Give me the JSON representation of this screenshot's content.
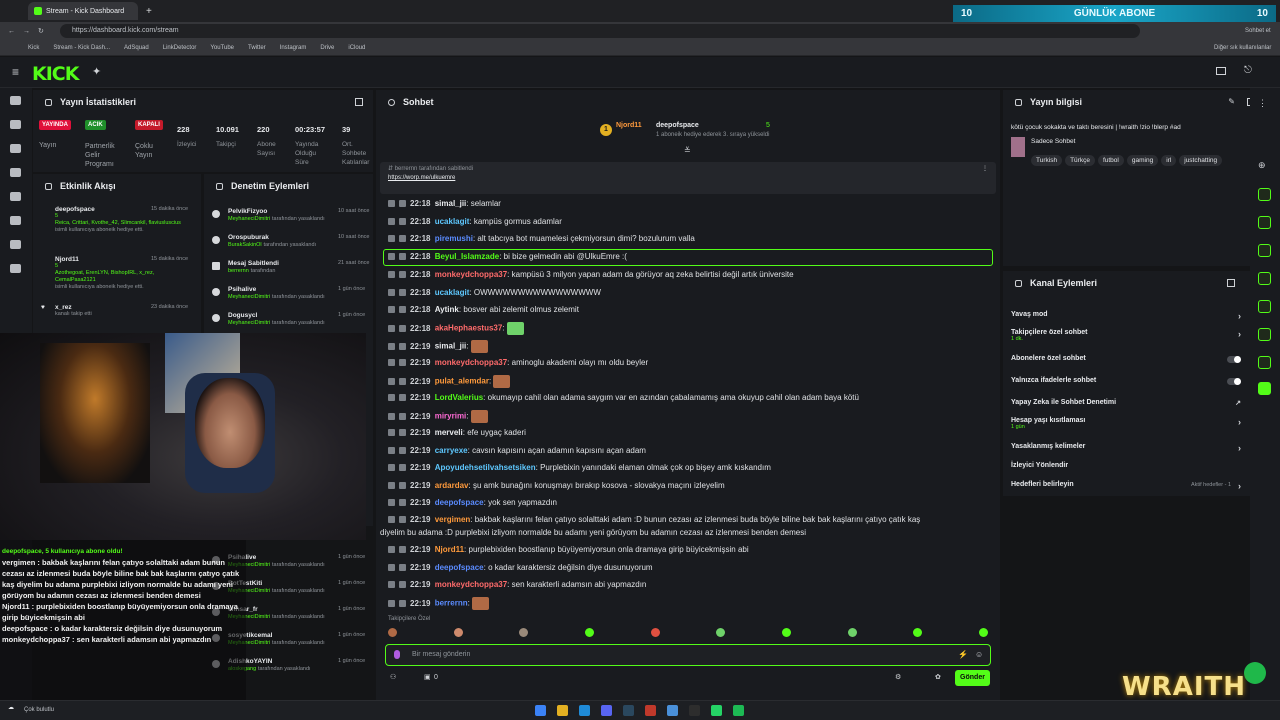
{
  "browser": {
    "tab_title": "Stream - Kick Dashboard",
    "url": "https://dashboard.kick.com/stream",
    "bookmarks": [
      "Kick",
      "Stream - Kick Dash...",
      "AdSquad",
      "LinkDetector",
      "YouTube",
      "Twitter",
      "Instagram",
      "Drive",
      "iCloud"
    ],
    "other_bookmarks": "Diğer sık kullanılanlar",
    "profile_btn": "Sohbet et"
  },
  "overlay_banner": {
    "left": "10",
    "title": "GÜNLÜK ABONE",
    "right": "10"
  },
  "stats": {
    "title": "Yayın İstatistikleri",
    "cols": [
      {
        "badge": "YAYINDA",
        "label": "Yayın"
      },
      {
        "badge": "ACIK",
        "label": "Partnerlik Gelir Programı"
      },
      {
        "badge": "KAPALI",
        "label": "Çoklu Yayın"
      }
    ],
    "nums": [
      {
        "v": "228",
        "l": "İzleyici"
      },
      {
        "v": "10.091",
        "l": "Takipçi"
      },
      {
        "v": "220",
        "l": "Abone Sayısı"
      },
      {
        "v": "00:23:57",
        "l": "Yayında Olduğu Süre"
      },
      {
        "v": "39",
        "l": "Ort. Sohbete Katılanlar"
      }
    ]
  },
  "activity": {
    "title": "Etkinlik Akışı",
    "items": [
      {
        "name": "deepofspace",
        "time": "15 dakika önce",
        "sub": "5",
        "list": "Reica, Crittari, Kvothe_42, Slimcankil, flaviusluscius",
        "note": "isimli kullanıcıya aboneik hediye etti."
      },
      {
        "name": "Njord11",
        "time": "15 dakika önce",
        "sub": "5",
        "list": "Azothegoat, ErenLYN, BishopIRL, x_rez, CemalPasa2121",
        "note": "isimli kullanıcıya aboneik hediye etti."
      },
      {
        "name": "x_rez",
        "time": "23 dakika önce",
        "note": "kanalı takip etti"
      }
    ]
  },
  "audit": {
    "title": "Denetim Eylemleri",
    "items": [
      {
        "name": "PelvikFizyoo",
        "time": "10 saat önce",
        "by": "MeyhaneciDimitri",
        "act": "tarafından yasaklandı"
      },
      {
        "name": "Orospuburak",
        "time": "10 saat önce",
        "by": "BurakSakinOl",
        "act": "tarafından yasaklandı"
      },
      {
        "name": "Mesaj Sabitlendi",
        "time": "21 saat önce",
        "by": "berrernn",
        "act": "tarafından"
      },
      {
        "name": "Psihalive",
        "time": "1 gün önce",
        "by": "MeyhaneciDimitri",
        "act": "tarafından yasaklandı"
      },
      {
        "name": "Dogusycl",
        "time": "1 gün önce",
        "by": "MeyhaneciDimitri",
        "act": "tarafından yasaklandı"
      }
    ],
    "items2": [
      {
        "name": "Psihalive",
        "time": "1 gün önce",
        "by": "MeyhaneciDimitri",
        "act": "tarafından yasaklandı"
      },
      {
        "name": "BotTestKiti",
        "time": "1 gün önce",
        "by": "MeyhaneciDimitri",
        "act": "tarafından yasaklandı"
      },
      {
        "name": "ennsar_fr",
        "time": "1 gün önce",
        "by": "MeyhaneciDimitri",
        "act": "tarafından yasaklandı"
      },
      {
        "name": "sosyetikcemal",
        "time": "1 gün önce",
        "by": "MeyhaneciDimitri",
        "act": "tarafından yasaklandı"
      },
      {
        "name": "AdishkoYAYIN",
        "time": "1 gün önce",
        "by": "aloskegang",
        "act": "tarafından yasaklandı"
      }
    ]
  },
  "overlay_chat": [
    "deepofspace, 5 kullanıcıya abone oldu!",
    "vergimen : bakbak kaşlarını felan çatıyo solalttaki adam bunun cezası az izlenmesi buda böyle biline bak bak kaşlarını çatıyo çatık kaş diyelim bu adama purplebixi izliyom normalde bu adamı yeni görüyom bu adamın cezası az izlenmesi benden demesi",
    "Njord11 : purplebixiden boostlanıp büyüyemiyorsun onla dramaya girip büyicekmişsin abi",
    "deepofspace : o kadar karaktersiz değilsin diye dusunuyorum",
    "monkeydchoppa37 : sen karakterli adamsın abi yapmazdın"
  ],
  "chat": {
    "title": "Sohbet",
    "top_user": "Njord11",
    "top_user2": "deepofspace",
    "top_count": "5",
    "top_note": "1 aboneik hediye ederek 3. sıraya yükseldi",
    "top_rank": "1",
    "pinned_by": "berrernn",
    "pinned_by_suffix": "tarafından sabitlendi",
    "pinned_link": "https://worp.me/ulkuemre",
    "messages": [
      {
        "t": "22:18",
        "u": "simal_jii",
        "c": "#e9ebee",
        "m": "selamlar"
      },
      {
        "t": "22:18",
        "u": "ucaklagit",
        "c": "#5ec8ff",
        "m": "kampüs gormus adamlar"
      },
      {
        "t": "22:18",
        "u": "piremushi",
        "c": "#5b8cff",
        "m": "alt tabcıya bot muamelesi çekmiyorsun dimi? bozulurum valla"
      },
      {
        "t": "22:18",
        "u": "Beyul_Islamzade",
        "c": "#53fc18",
        "m": "bi bize gelmedin abi @UlkuEmre :("
      },
      {
        "t": "22:18",
        "u": "monkeydchoppa37",
        "c": "#ff6b6b",
        "m": "kampüsü 3 milyon yapan adam da görüyor aq zeka belirtisi değil artık üniversite"
      },
      {
        "t": "22:18",
        "u": "ucaklagit",
        "c": "#5ec8ff",
        "m": "OWWWWWWWWWWWWWWWW"
      },
      {
        "t": "22:18",
        "u": "Aytink",
        "c": "#e9ebee",
        "m": "bosver abi zelemit olmus zelemit"
      },
      {
        "t": "22:18",
        "u": "akaHephaestus37",
        "c": "#ff6b6b",
        "m": ""
      },
      {
        "t": "22:19",
        "u": "simal_jii",
        "c": "#e9ebee",
        "m": ""
      },
      {
        "t": "22:19",
        "u": "monkeydchoppa37",
        "c": "#ff6b6b",
        "m": "aminoglu akademi olayı mı oldu beyler"
      },
      {
        "t": "22:19",
        "u": "pulat_alemdar",
        "c": "#ff9a3c",
        "m": ""
      },
      {
        "t": "22:19",
        "u": "LordValerius",
        "c": "#53fc18",
        "m": "okumayıp cahil olan adama saygım var en azından çabalamamış ama okuyup cahil olan adam baya kötü"
      },
      {
        "t": "22:19",
        "u": "miryrimi",
        "c": "#ff6ad5",
        "m": ""
      },
      {
        "t": "22:19",
        "u": "merveli",
        "c": "#e9ebee",
        "m": "efe uygaç kaderi"
      },
      {
        "t": "22:19",
        "u": "carryexe",
        "c": "#5ec8ff",
        "m": "cavsın kapısını açan adamın kapısını açan adam"
      },
      {
        "t": "22:19",
        "u": "Apoyudehsetilvahsetsiken",
        "c": "#5ec8ff",
        "m": "Purplebixin yanındaki elaman olmak çok op bişey amk kıskandım"
      },
      {
        "t": "22:19",
        "u": "ardardav",
        "c": "#ff9a3c",
        "m": "şu amk bunağını konuşmayı bırakıp kosova - slovakya maçını izleyelim"
      },
      {
        "t": "22:19",
        "u": "deepofspace",
        "c": "#5b8cff",
        "m": "yok sen yapmazdın"
      },
      {
        "t": "22:19",
        "u": "vergimen",
        "c": "#ff9a3c",
        "m": "bakbak kaşlarını felan çatıyo solalttaki adam :D bunun cezası az izlenmesi buda böyle biline bak bak kaşlarını çatıyo çatık kaş"
      },
      {
        "t": "",
        "u": "",
        "c": "#e9ebee",
        "m": "diyelim bu adama :D purplebixi izliyom normalde bu adamı yeni görüyom bu adamın cezası az izlenmesi benden demesi"
      },
      {
        "t": "22:19",
        "u": "Njord11",
        "c": "#ff9a3c",
        "m": "purplebixiden boostlanıp büyüyemiyorsun onla dramaya girip büyicekmişsin abi"
      },
      {
        "t": "22:19",
        "u": "deepofspace",
        "c": "#5b8cff",
        "m": "o kadar karaktersiz değilsin diye dusunuyorum"
      },
      {
        "t": "22:19",
        "u": "monkeydchoppa37",
        "c": "#ff6b6b",
        "m": "sen karakterli adamsın abi yapmazdın"
      },
      {
        "t": "22:19",
        "u": "berrernn",
        "c": "#5b8cff",
        "m": ""
      }
    ],
    "followers_label": "Takipçilere Özel",
    "input_placeholder": "Bir mesaj gönderin",
    "send": "Gönder",
    "count": "0"
  },
  "yayin": {
    "title": "Yayın bilgisi",
    "desc": "kötü çocuk sokakta ve taktı beresini | !wraith !zio !blerp #ad",
    "category": "Sadece Sohbet",
    "tags": [
      "Turkish",
      "Türkçe",
      "futbol",
      "gaming",
      "irl",
      "justchatting"
    ]
  },
  "kanal": {
    "title": "Kanal Eylemleri",
    "rows": [
      {
        "l": "Yavaş mod",
        "type": "chev"
      },
      {
        "l": "Takipçilere özel sohbet",
        "sub": "1 dk.",
        "type": "chev"
      },
      {
        "l": "Abonelere özel sohbet",
        "type": "toggle"
      },
      {
        "l": "Yalnızca ifadelerle sohbet",
        "type": "toggle"
      },
      {
        "l": "Yapay Zeka ile Sohbet Denetimi",
        "type": "ext"
      },
      {
        "l": "Hesap yaşı kısıtlaması",
        "sub": "1 gün",
        "type": "chev"
      },
      {
        "l": "Yasaklanmış kelimeler",
        "type": "chev"
      },
      {
        "l": "İzleyici Yönlendir",
        "type": "none"
      },
      {
        "l": "Hedefleri belirleyin",
        "type": "chev",
        "extra": "Aktif hedefler - 1"
      }
    ]
  },
  "taskbar": {
    "weather": "Çok bulutlu"
  },
  "brand_overlay": "WRAITH"
}
